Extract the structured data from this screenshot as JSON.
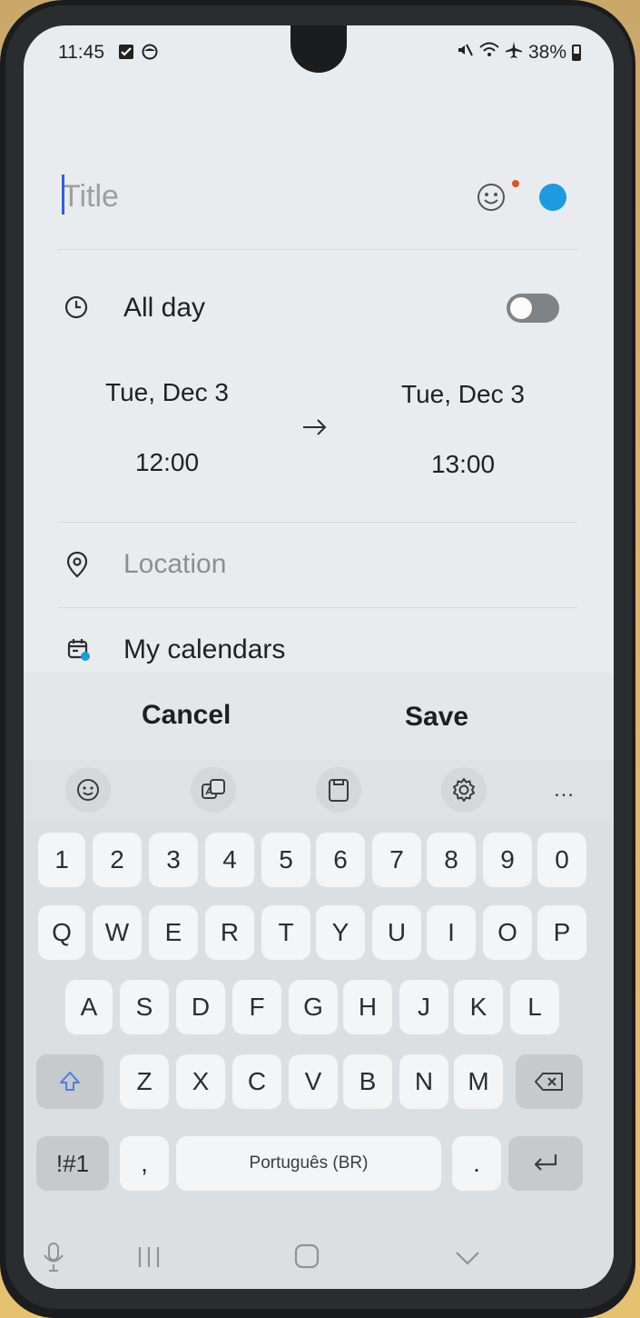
{
  "status_bar": {
    "time": "11:45",
    "battery": "38%"
  },
  "event": {
    "title_placeholder": "Title",
    "all_day_label": "All day",
    "all_day_enabled": false,
    "start_date": "Tue, Dec 3",
    "start_time": "12:00",
    "end_date": "Tue, Dec 3",
    "end_time": "13:00",
    "location_placeholder": "Location",
    "calendar_label": "My calendars",
    "color": "#1e9be0"
  },
  "actions": {
    "cancel_label": "Cancel",
    "save_label": "Save"
  },
  "keyboard": {
    "toolbar_more": "…",
    "number_row": [
      "1",
      "2",
      "3",
      "4",
      "5",
      "6",
      "7",
      "8",
      "9",
      "0"
    ],
    "row1": [
      "Q",
      "W",
      "E",
      "R",
      "T",
      "Y",
      "U",
      "I",
      "O",
      "P"
    ],
    "row2": [
      "A",
      "S",
      "D",
      "F",
      "G",
      "H",
      "J",
      "K",
      "L"
    ],
    "row3": [
      "Z",
      "X",
      "C",
      "V",
      "B",
      "N",
      "M"
    ],
    "symbols_label": "!#1",
    "comma_label": ",",
    "space_label": "Português (BR)",
    "period_label": "."
  }
}
